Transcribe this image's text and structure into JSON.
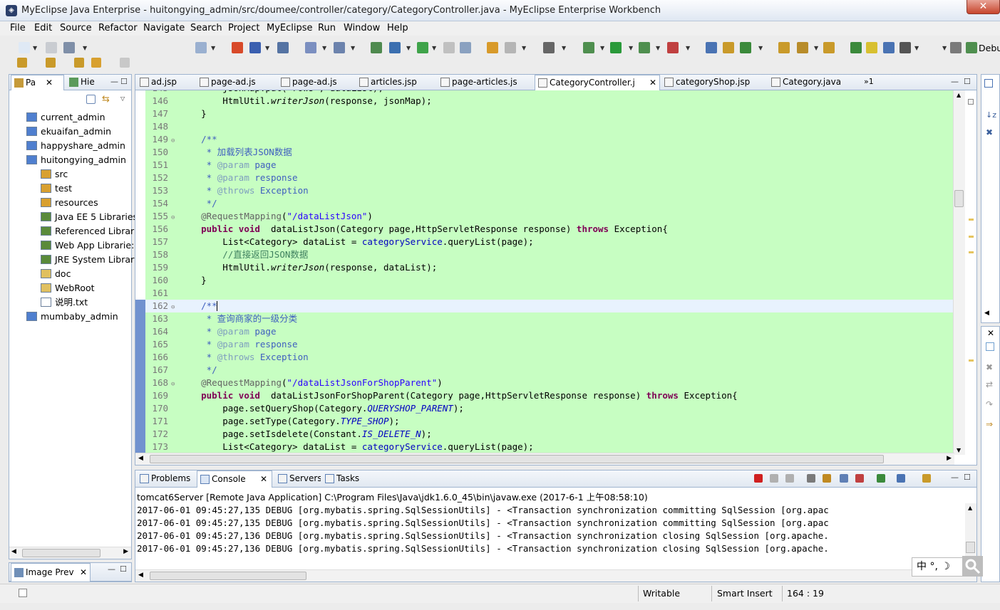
{
  "window": {
    "title": "MyEclipse Java Enterprise - huitongying_admin/src/doumee/controller/category/CategoryController.java - MyEclipse Enterprise Workbench",
    "close_glyph": "✕"
  },
  "menu": [
    "File",
    "Edit",
    "Source",
    "Refactor",
    "Navigate",
    "Search",
    "Project",
    "MyEclipse",
    "Run",
    "Window",
    "Help"
  ],
  "left_panel": {
    "tabs": [
      "Pa",
      "Hie"
    ],
    "tree": [
      {
        "label": "current_admin",
        "level": 0,
        "icon": "project-icon"
      },
      {
        "label": "ekuaifan_admin",
        "level": 0,
        "icon": "project-icon"
      },
      {
        "label": "happyshare_admin",
        "level": 0,
        "icon": "project-icon"
      },
      {
        "label": "huitongying_admin",
        "level": 0,
        "icon": "project-icon"
      },
      {
        "label": "src",
        "level": 1,
        "icon": "source-folder-icon"
      },
      {
        "label": "test",
        "level": 1,
        "icon": "source-folder-icon"
      },
      {
        "label": "resources",
        "level": 1,
        "icon": "source-folder-icon"
      },
      {
        "label": "Java EE 5 Libraries",
        "level": 1,
        "icon": "library-icon"
      },
      {
        "label": "Referenced Librar",
        "level": 1,
        "icon": "library-icon"
      },
      {
        "label": "Web App Librarie:",
        "level": 1,
        "icon": "library-icon"
      },
      {
        "label": "JRE System Library",
        "level": 1,
        "icon": "library-icon"
      },
      {
        "label": "doc",
        "level": 1,
        "icon": "folder-icon"
      },
      {
        "label": "WebRoot",
        "level": 1,
        "icon": "folder-icon"
      },
      {
        "label": "说明.txt",
        "level": 1,
        "icon": "text-file-icon"
      },
      {
        "label": "mumbaby_admin",
        "level": 0,
        "icon": "project-icon"
      }
    ],
    "bottom_tab": "Image Prev"
  },
  "editor": {
    "tabs": [
      "ad.jsp",
      "page-ad.js",
      "page-ad.js",
      "articles.jsp",
      "page-articles.js",
      "CategoryController.j",
      "categoryShop.jsp",
      "Category.java"
    ],
    "overflow": "»1",
    "active_tab_index": 5
  },
  "code_lines": [
    {
      "n": "146",
      "html": "        HtmlUtil.<span class=\"it\">writerJson</span>(response, jsonMap);"
    },
    {
      "n": "147",
      "html": "    }"
    },
    {
      "n": "148",
      "html": ""
    },
    {
      "n": "149",
      "fold": true,
      "html": "    <span class=\"jd\">/**</span>"
    },
    {
      "n": "150",
      "html": "<span class=\"jd\">     * 加载列表JSON数据</span>"
    },
    {
      "n": "151",
      "html": "<span class=\"jd\">     * <span class=\"jtag\">@param</span> page</span>"
    },
    {
      "n": "152",
      "html": "<span class=\"jd\">     * <span class=\"jtag\">@param</span> response</span>"
    },
    {
      "n": "153",
      "html": "<span class=\"jd\">     * <span class=\"jtag\">@throws</span> Exception</span>"
    },
    {
      "n": "154",
      "html": "<span class=\"jd\">     */</span>"
    },
    {
      "n": "155",
      "fold": true,
      "html": "    <span class=\"ann\">@RequestMapping</span>(<span class=\"str\">\"/dataListJson\"</span>)"
    },
    {
      "n": "156",
      "html": "    <span class=\"kw\">public</span> <span class=\"kw\">void</span>  dataListJson(Category page,HttpServletResponse response) <span class=\"kw\">throws</span> Exception{"
    },
    {
      "n": "157",
      "html": "        List&lt;Category&gt; dataList = <span class=\"fld2\">categoryService</span>.queryList(page);"
    },
    {
      "n": "158",
      "html": "        <span class=\"cm\">//直接返回JSON数据</span>"
    },
    {
      "n": "159",
      "html": "        HtmlUtil.<span class=\"it\">writerJson</span>(response, dataList);"
    },
    {
      "n": "160",
      "html": "    }"
    },
    {
      "n": "161",
      "html": ""
    },
    {
      "n": "162",
      "fold": true,
      "cur": true,
      "html": "    <span class=\"jd\">/**</span>"
    },
    {
      "n": "163",
      "html": "<span class=\"jd\">     * 查询商家的一级分类</span>"
    },
    {
      "n": "164",
      "html": "<span class=\"jd\">     * <span class=\"jtag\">@param</span> page</span>"
    },
    {
      "n": "165",
      "html": "<span class=\"jd\">     * <span class=\"jtag\">@param</span> response</span>"
    },
    {
      "n": "166",
      "html": "<span class=\"jd\">     * <span class=\"jtag\">@throws</span> Exception</span>"
    },
    {
      "n": "167",
      "html": "<span class=\"jd\">     */</span>"
    },
    {
      "n": "168",
      "fold": true,
      "html": "    <span class=\"ann\">@RequestMapping</span>(<span class=\"str\">\"/dataListJsonForShopParent\"</span>)"
    },
    {
      "n": "169",
      "html": "    <span class=\"kw\">public</span> <span class=\"kw\">void</span>  dataListJsonForShopParent(Category page,HttpServletResponse response) <span class=\"kw\">throws</span> Exception{"
    },
    {
      "n": "170",
      "html": "        page.setQueryShop(Category.<span class=\"fld\">QUERYSHOP_PARENT</span>);"
    },
    {
      "n": "171",
      "html": "        page.setType(Category.<span class=\"fld\">TYPE_SHOP</span>);"
    },
    {
      "n": "172",
      "html": "        page.setIsdelete(Constant.<span class=\"fld\">IS_DELETE_N</span>);"
    },
    {
      "n": "173",
      "html": "        List&lt;Category&gt; dataList = <span class=\"fld2\">categoryService</span>.queryList(page);"
    }
  ],
  "console": {
    "tabs": [
      "Problems",
      "Console",
      "Servers",
      "Tasks"
    ],
    "header": "tomcat6Server [Remote Java Application] C:\\Program Files\\Java\\jdk1.6.0_45\\bin\\javaw.exe (2017-6-1 上午08:58:10)",
    "lines": [
      "2017-06-01 09:45:27,135 DEBUG [org.mybatis.spring.SqlSessionUtils] - <Transaction synchronization committing SqlSession [org.apac",
      "2017-06-01 09:45:27,135 DEBUG [org.mybatis.spring.SqlSessionUtils] - <Transaction synchronization committing SqlSession [org.apac",
      "2017-06-01 09:45:27,136 DEBUG [org.mybatis.spring.SqlSessionUtils] - <Transaction synchronization closing SqlSession [org.apache.",
      "2017-06-01 09:45:27,136 DEBUG [org.mybatis.spring.SqlSessionUtils] - <Transaction synchronization closing SqlSession [org.apache."
    ]
  },
  "status": {
    "writable": "Writable",
    "insert_mode": "Smart Insert",
    "position": "164 : 19"
  },
  "ime": "中 °, ☽",
  "toolbar_overflow": "Debu",
  "colors": {
    "code_bg": "#c7fec2",
    "keyword": "#7f0055",
    "string": "#2a00ff",
    "javadoc": "#3f5fbf",
    "comment": "#3f7f5f"
  }
}
